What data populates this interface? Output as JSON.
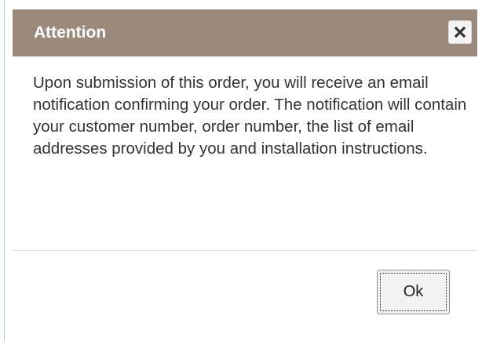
{
  "dialog": {
    "title": "Attention",
    "close_icon": "close-icon",
    "message": "Upon submission of this order, you will receive an email notification confirming your order. The notification will contain your customer number, order number, the list of email addresses provided by you and installation instructions.",
    "ok_label": "Ok"
  },
  "colors": {
    "titlebar": "#9b8a7c",
    "title_text": "#ffffff",
    "body_text": "#333333",
    "button_bg": "#f2f2f2"
  }
}
